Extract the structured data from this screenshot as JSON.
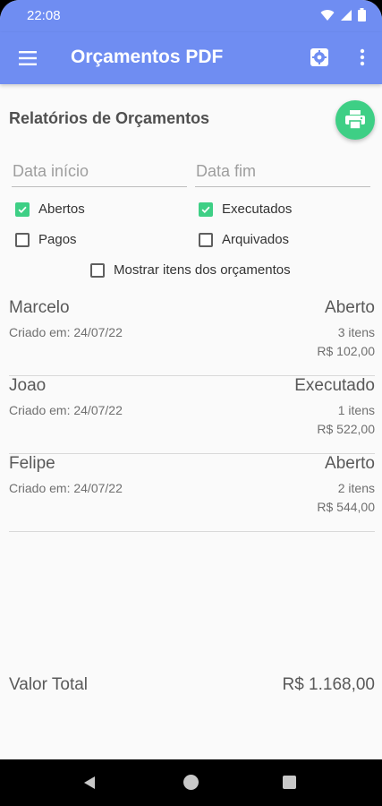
{
  "status_bar": {
    "time": "22:08"
  },
  "app_bar": {
    "title": "Orçamentos PDF"
  },
  "report": {
    "title": "Relatórios de Orçamentos",
    "date_start_placeholder": "Data início",
    "date_end_placeholder": "Data fim"
  },
  "filters": {
    "abertos": {
      "label": "Abertos",
      "checked": true
    },
    "executados": {
      "label": "Executados",
      "checked": true
    },
    "pagos": {
      "label": "Pagos",
      "checked": false
    },
    "arquivados": {
      "label": "Arquivados",
      "checked": false
    },
    "mostrar_itens": {
      "label": "Mostrar itens dos orçamentos",
      "checked": false
    }
  },
  "budgets": [
    {
      "name": "Marcelo",
      "created": "Criado em: 24/07/22",
      "status": "Aberto",
      "items": "3 itens",
      "value": "R$ 102,00"
    },
    {
      "name": "Joao",
      "created": "Criado em: 24/07/22",
      "status": "Executado",
      "items": "1 itens",
      "value": "R$ 522,00"
    },
    {
      "name": "Felipe",
      "created": "Criado em: 24/07/22",
      "status": "Aberto",
      "items": "2 itens",
      "value": "R$ 544,00"
    }
  ],
  "total": {
    "label": "Valor Total",
    "value": "R$ 1.168,00"
  },
  "colors": {
    "primary": "#6f8df2",
    "accent": "#3ecf85"
  }
}
